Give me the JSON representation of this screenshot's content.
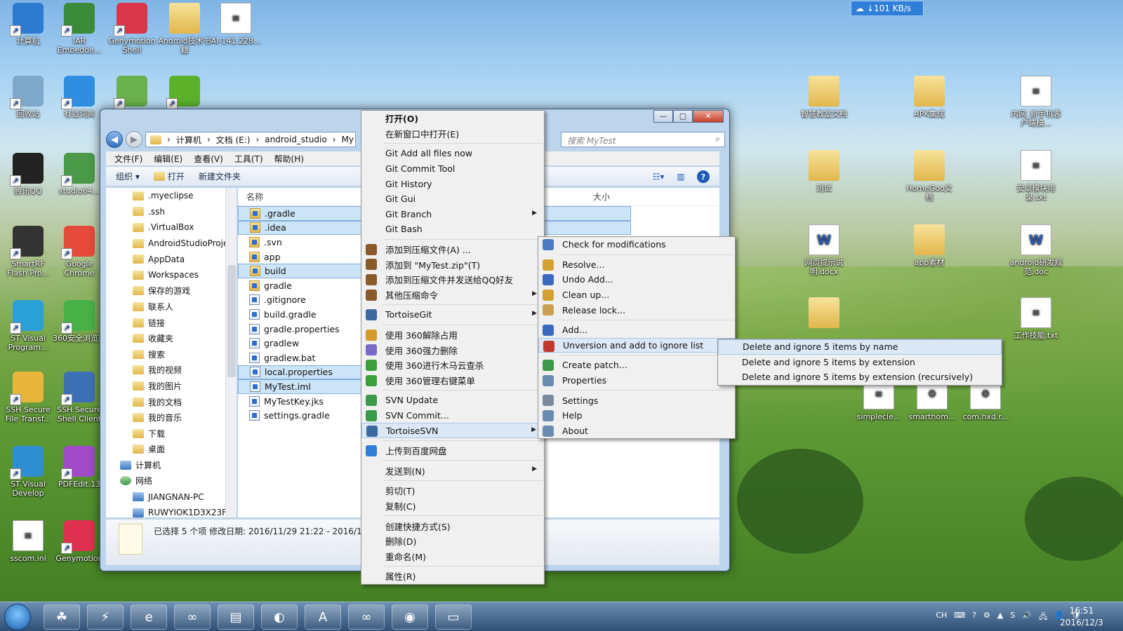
{
  "speed_badge": "↓101 KB/s",
  "desktop": {
    "left_icons": [
      "计算机",
      "IAR Embedde...",
      "Genymotion Shell",
      "Android技术书籍",
      "AI-141.228...",
      "回收站",
      "有道词典",
      "",
      "",
      "腾讯QQ",
      "studio64...",
      "SmartRF Flash Pro...",
      "Google Chrome",
      "ST Visual Program...",
      "360安全浏览器",
      "SSH Secure File Transf...",
      "SSH Secure Shell Client",
      "ST Visual Develop",
      "PDFEdit.13",
      "sscom.ini",
      "Genymotion"
    ],
    "right_icons": [
      "智慧教室文档",
      "APK集成",
      "内网_新手机客户端模...",
      "测试",
      "HomeGoo文档",
      "安卓模块用录.txt",
      "网页提示说明.docx",
      "app素材",
      "android研发规范.doc",
      "",
      "工作技能.txt",
      "simplecle...",
      "smarthom...",
      "com.hxd.r..."
    ]
  },
  "explorer": {
    "window_buttons": [
      "—",
      "▢",
      "✕"
    ],
    "breadcrumb": [
      "计算机",
      "文档 (E:)",
      "android_studio",
      "My"
    ],
    "search_placeholder": "搜索 MyTest",
    "menu": [
      "文件(F)",
      "编辑(E)",
      "查看(V)",
      "工具(T)",
      "帮助(H)"
    ],
    "toolbar": {
      "organize": "组织 ▾",
      "open": "打开",
      "new_folder": "新建文件夹"
    },
    "nav_items": [
      ".myeclipse",
      ".ssh",
      ".VirtualBox",
      "AndroidStudioProje",
      "AppData",
      "Workspaces",
      "保存的游戏",
      "联系人",
      "链接",
      "收藏夹",
      "搜索",
      "我的视频",
      "我的图片",
      "我的文档",
      "我的音乐",
      "下载",
      "桌面"
    ],
    "nav_root": [
      "计算机",
      "网络"
    ],
    "nav_network": [
      "JIANGNAN-PC",
      "RUWYIOK1D3X23F:"
    ],
    "columns": {
      "name": "名称",
      "size": "大小"
    },
    "files": [
      {
        "name": ".gradle",
        "sel": true,
        "folder": true
      },
      {
        "name": ".idea",
        "sel": true,
        "folder": true
      },
      {
        "name": ".svn",
        "sel": false,
        "folder": true
      },
      {
        "name": "app",
        "sel": false,
        "folder": true
      },
      {
        "name": "build",
        "sel": true,
        "folder": true
      },
      {
        "name": "gradle",
        "sel": false,
        "folder": true
      },
      {
        "name": ".gitignore",
        "sel": false,
        "folder": false
      },
      {
        "name": "build.gradle",
        "sel": false,
        "folder": false
      },
      {
        "name": "gradle.properties",
        "sel": false,
        "folder": false
      },
      {
        "name": "gradlew",
        "sel": false,
        "folder": false
      },
      {
        "name": "gradlew.bat",
        "sel": false,
        "folder": false
      },
      {
        "name": "local.properties",
        "sel": true,
        "folder": false
      },
      {
        "name": "MyTest.iml",
        "sel": true,
        "folder": false
      },
      {
        "name": "MyTestKey.jks",
        "sel": false,
        "folder": false
      },
      {
        "name": "settings.gradle",
        "sel": false,
        "folder": false
      }
    ],
    "status": "已选择 5 个项   修改日期: 2016/11/29 21:22 - 2016/1"
  },
  "context_menu": [
    {
      "label": "打开(O)",
      "bold": true
    },
    {
      "label": "在新窗口中打开(E)"
    },
    {
      "sep": true
    },
    {
      "label": "Git Add all files now"
    },
    {
      "label": "Git Commit Tool"
    },
    {
      "label": "Git History"
    },
    {
      "label": "Git Gui"
    },
    {
      "label": "Git Branch",
      "sub": true
    },
    {
      "label": "Git Bash"
    },
    {
      "sep": true
    },
    {
      "label": "添加到压缩文件(A) ...",
      "icon": "winrar-icon",
      "color": "#8a5a2b"
    },
    {
      "label": "添加到 \"MyTest.zip\"(T)",
      "icon": "winrar-icon",
      "color": "#8a5a2b"
    },
    {
      "label": "添加到压缩文件并发送给QQ好友",
      "icon": "winrar-icon",
      "color": "#8a5a2b"
    },
    {
      "label": "其他压缩命令",
      "icon": "winrar-icon",
      "color": "#8a5a2b",
      "sub": true
    },
    {
      "sep": true
    },
    {
      "label": "TortoiseGit",
      "icon": "tortoise-icon",
      "color": "#3a6a9e",
      "sub": true
    },
    {
      "sep": true
    },
    {
      "label": "使用 360解除占用",
      "icon": "unlock-icon",
      "color": "#d49a2a"
    },
    {
      "label": "使用 360强力删除",
      "icon": "delete-icon",
      "color": "#7a6ac8"
    },
    {
      "label": "使用 360进行木马云查杀",
      "icon": "shield-360-icon",
      "color": "#3aa03a"
    },
    {
      "label": "使用 360管理右键菜单",
      "icon": "shield-360-icon",
      "color": "#3aa03a"
    },
    {
      "sep": true
    },
    {
      "label": "SVN Update",
      "icon": "svn-update-icon",
      "color": "#3a9a4a"
    },
    {
      "label": "SVN Commit...",
      "icon": "svn-commit-icon",
      "color": "#3a9a4a"
    },
    {
      "label": "TortoiseSVN",
      "icon": "tortoise-icon",
      "color": "#3a6a9e",
      "sub": true,
      "hl": true
    },
    {
      "sep": true
    },
    {
      "label": "上传到百度网盘",
      "icon": "baidu-cloud-icon",
      "color": "#2f7fd8"
    },
    {
      "sep": true
    },
    {
      "label": "发送到(N)",
      "sub": true
    },
    {
      "sep": true
    },
    {
      "label": "剪切(T)"
    },
    {
      "label": "复制(C)"
    },
    {
      "sep": true
    },
    {
      "label": "创建快捷方式(S)"
    },
    {
      "label": "删除(D)"
    },
    {
      "label": "重命名(M)"
    },
    {
      "sep": true
    },
    {
      "label": "属性(R)"
    }
  ],
  "svn_menu": [
    {
      "label": "Check for modifications",
      "icon": "check-mods-icon",
      "color": "#4a7ac0"
    },
    {
      "sep": true
    },
    {
      "label": "Resolve...",
      "icon": "resolve-icon",
      "color": "#d4a030"
    },
    {
      "label": "Undo Add...",
      "icon": "undo-icon",
      "color": "#3a6ac0"
    },
    {
      "label": "Clean up...",
      "icon": "cleanup-icon",
      "color": "#d4a030"
    },
    {
      "label": "Release lock...",
      "icon": "lock-icon",
      "color": "#c8a050"
    },
    {
      "sep": true
    },
    {
      "label": "Add...",
      "icon": "add-icon",
      "color": "#3a6ac0"
    },
    {
      "label": "Unversion and add to ignore list",
      "icon": "ignore-icon",
      "color": "#c0392b",
      "sub": true,
      "hl": true
    },
    {
      "sep": true
    },
    {
      "label": "Create patch...",
      "icon": "patch-icon",
      "color": "#3a9a4a"
    },
    {
      "label": "Properties",
      "icon": "properties-icon",
      "color": "#6a8ab0"
    },
    {
      "sep": true
    },
    {
      "label": "Settings",
      "icon": "settings-icon",
      "color": "#7a8a9a"
    },
    {
      "label": "Help",
      "icon": "help-icon",
      "color": "#6a8ab0"
    },
    {
      "label": "About",
      "icon": "about-icon",
      "color": "#6a8ab0"
    }
  ],
  "ignore_menu": [
    {
      "label": "Delete and ignore 5 items by name",
      "hl": true
    },
    {
      "label": "Delete and ignore 5 items by extension"
    },
    {
      "label": "Delete and ignore 5 items by extension (recursively)"
    }
  ],
  "taskbar": {
    "apps": [
      "start-orb",
      "android-icon",
      "shell-icon",
      "360-browser-icon",
      "genymotion-icon",
      "explorer-icon",
      "qq-browser-icon",
      "android-studio-icon",
      "genymotion-icon",
      "chrome-icon",
      "book-icon"
    ],
    "tray": [
      "CH",
      "⌨",
      "?",
      "⚙",
      "▲",
      "S",
      "🔊",
      "🖧",
      "👤",
      "🛡"
    ],
    "time": "16:51",
    "date": "2016/12/3"
  }
}
